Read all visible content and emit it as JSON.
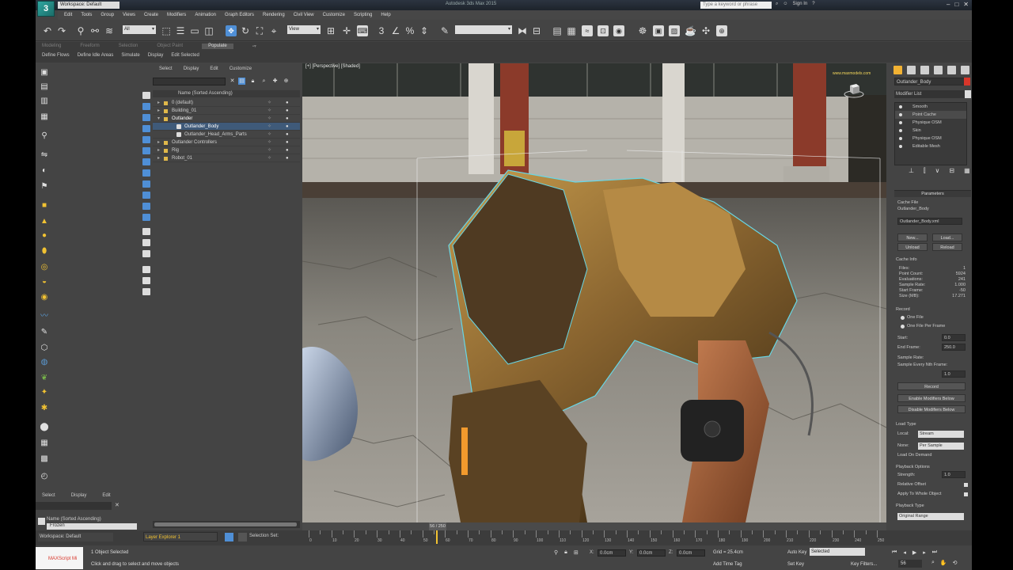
{
  "app": {
    "workspace": "Workspace: Default",
    "title": "Autodesk 3ds Max 2015",
    "search_placeholder": "Type a keyword or phrase",
    "sign_in": "Sign In"
  },
  "menu": [
    "Edit",
    "Tools",
    "Group",
    "Views",
    "Create",
    "Modifiers",
    "Animation",
    "Graph Editors",
    "Rendering",
    "Civil View",
    "Customize",
    "Scripting",
    "Help"
  ],
  "toolbar": {
    "selection_filter": "All",
    "ref_coord": "View",
    "named_sel_placeholder": ""
  },
  "ribbon": {
    "tabs": [
      "Modeling",
      "Freeform",
      "Selection",
      "Object Paint",
      "Populate"
    ],
    "active_tab": "Populate",
    "sub": [
      "Define Flows",
      "Define Idle Areas",
      "Simulate",
      "Display",
      "Edit Selected"
    ]
  },
  "scene_explorer": {
    "menu": [
      "Select",
      "Display",
      "Edit",
      "Customize"
    ],
    "header": "Name (Sorted Ascending)",
    "rows": [
      {
        "label": "0 (default)",
        "indent": 1,
        "kind": "layer"
      },
      {
        "label": "Building_01",
        "indent": 1,
        "kind": "layer"
      },
      {
        "label": "Outlander",
        "indent": 1,
        "kind": "layer",
        "active": true
      },
      {
        "label": "Outlander_Body",
        "indent": 2,
        "kind": "object",
        "selected": true
      },
      {
        "label": "Outlander_Head_Arms_Parts",
        "indent": 2,
        "kind": "object"
      },
      {
        "label": "Outlander Controllers",
        "indent": 1,
        "kind": "layer"
      },
      {
        "label": "Rig",
        "indent": 1,
        "kind": "layer"
      },
      {
        "label": "Robot_01",
        "indent": 1,
        "kind": "layer"
      }
    ]
  },
  "mini_explorer": {
    "menu": [
      "Select",
      "Display",
      "Edit"
    ],
    "row1": "Name (Sorted Ascending)",
    "row2": "Frozen"
  },
  "viewport": {
    "label": "[+] [Perspective] [Shaded]",
    "watermark": "www.maxmodels.com"
  },
  "command_panel": {
    "object_name": "Outlander_Body",
    "modifier_list": "Modifier List",
    "stack": [
      "Smooth",
      "Point Cache",
      "Physique OSM",
      "Skin",
      "Physique OSM",
      "Editable Mesh"
    ],
    "selected_stack_index": 1,
    "params": {
      "rollout_title": "Parameters",
      "cache_file_label": "Cache File",
      "cache_file_name": "Outlander_Body",
      "cache_file_path": "Outlander_Body.xml",
      "btn_new": "New...",
      "btn_load": "Load...",
      "btn_unload": "Unload",
      "btn_reload": "Reload",
      "cache_info_label": "Cache Info",
      "info": [
        {
          "k": "Files:",
          "v": "1"
        },
        {
          "k": "Point Count:",
          "v": "5924"
        },
        {
          "k": "Evaluations:",
          "v": "241"
        },
        {
          "k": "Sample Rate:",
          "v": "1.000"
        },
        {
          "k": "Start Frame:",
          "v": "-50"
        },
        {
          "k": "Size (MB):",
          "v": "17.271"
        }
      ],
      "record_label": "Record",
      "one_file": "One File",
      "one_file_per_frame": "One File Per Frame",
      "start_label": "Start:",
      "start_val": "0.0",
      "end_label": "End Frame:",
      "end_val": "250.0",
      "sample_label": "Sample Rate:",
      "sample_every": "Sample Every Nth Frame:",
      "sample_val": "1.0",
      "btn_record": "Record",
      "btn_enable_mods": "Enable Modifiers Below",
      "btn_disable_mods": "Disable Modifiers Below",
      "load_type_label": "Load Type",
      "local_label": "Local:",
      "local_val": "Stream",
      "none_label": "None:",
      "none_val": "Per Sample",
      "load_on_demand": "Load On Demand",
      "playback_options": "Playback Options",
      "strength_label": "Strength:",
      "strength_val": "1.0",
      "relative_offset": "Relative Offset",
      "apply_whole": "Apply To Whole Object",
      "playback_type": "Playback Type",
      "playback_type_val": "Original Range",
      "start_label2": "Start:"
    }
  },
  "timeline": {
    "thumb": "56 / 250",
    "tick_labels": [
      "0",
      "10",
      "20",
      "30",
      "40",
      "50",
      "60",
      "70",
      "80",
      "90",
      "100",
      "110",
      "120",
      "130",
      "140",
      "150",
      "160",
      "170",
      "180",
      "190",
      "200",
      "210",
      "220",
      "230",
      "240",
      "250"
    ]
  },
  "layer_bar": {
    "workspace": "Workspace: Default",
    "layer": "Layer Explorer 1",
    "selection_set": "Selection Set:"
  },
  "status": {
    "maxscript": "MAXScript Mi",
    "line1": "1 Object Selected",
    "line2": "Click and drag to select and move objects",
    "x_label": "X:",
    "x_val": "0.0cm",
    "y_label": "Y:",
    "y_val": "0.0cm",
    "z_label": "Z:",
    "z_val": "0.0cm",
    "grid": "Grid = 25.4cm",
    "add_time_tag": "Add Time Tag",
    "auto_key": "Auto Key",
    "selected": "Selected",
    "set_key": "Set Key",
    "key_filters": "Key Filters...",
    "frame": "56"
  }
}
